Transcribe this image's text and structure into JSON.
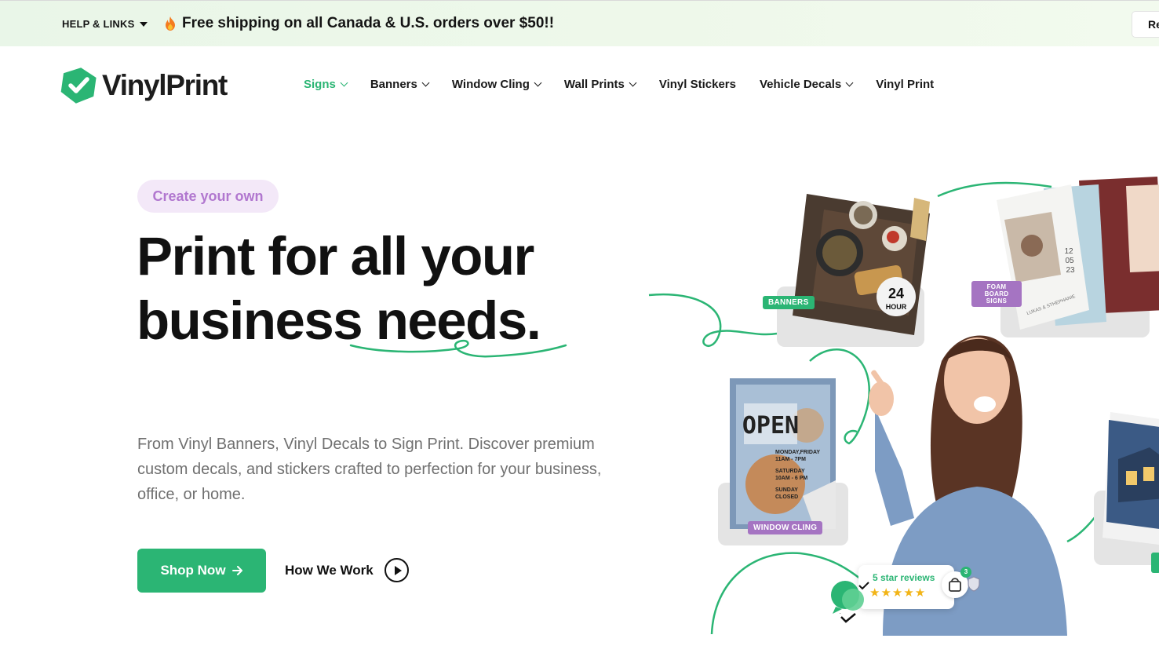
{
  "topbar": {
    "help_label": "HELP & LINKS",
    "promo_text": "Free shipping on all Canada & U.S. orders over $50!!",
    "right_button_label": "Re"
  },
  "header": {
    "logo_text": "VinylPrint",
    "nav": [
      {
        "label": "Signs",
        "has_dropdown": true,
        "active": true
      },
      {
        "label": "Banners",
        "has_dropdown": true
      },
      {
        "label": "Window Cling",
        "has_dropdown": true
      },
      {
        "label": "Wall Prints",
        "has_dropdown": true
      },
      {
        "label": "Vinyl Stickers",
        "has_dropdown": false
      },
      {
        "label": "Vehicle Decals",
        "has_dropdown": true
      },
      {
        "label": "Vinyl Print",
        "has_dropdown": false
      }
    ]
  },
  "hero": {
    "pill": "Create your own",
    "headline_line1": "Print for all your",
    "headline_line2": "business needs.",
    "description": "From Vinyl Banners, Vinyl Decals to Sign Print. Discover premium custom decals, and stickers crafted to perfection for your business, office, or home.",
    "primary_button": "Shop Now",
    "secondary_link": "How We Work"
  },
  "art": {
    "tags": {
      "banners": "BANNERS",
      "foam_board": "FOAM BOARD SIGNS",
      "window_cling": "WINDOW CLING"
    },
    "banner_badge_number": "24",
    "banner_badge_word": "HOUR",
    "open_sign_title": "OPEN",
    "open_sign_hours": [
      "MONDAY,FRIDAY",
      "11AM - 7PM",
      "SATURDAY",
      "10AM - 6 PM",
      "SUNDAY",
      "CLOSED"
    ],
    "foam_date": [
      "12",
      "05",
      "23"
    ],
    "foam_names": "LUKAS & STHEPHANIE",
    "reviews_label": "5 star reviews",
    "stars": "★★★★★",
    "cart_count": "3"
  },
  "colors": {
    "accent": "#2bb574",
    "pill_bg": "#f3e8f8",
    "pill_text": "#b177cf",
    "topbar_bg": "#eaf6e8"
  }
}
